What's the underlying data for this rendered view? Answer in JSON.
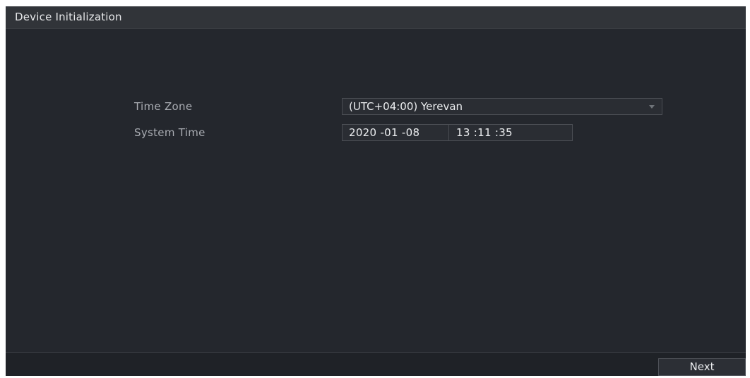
{
  "window": {
    "title": "Device Initialization"
  },
  "form": {
    "time_zone": {
      "label": "Time Zone",
      "value": "(UTC+04:00) Yerevan",
      "icon": "dropdown-arrow-icon"
    },
    "system_time": {
      "label": "System Time",
      "date": "2020 -01 -08",
      "time": "13 :11 :35"
    }
  },
  "footer": {
    "next_label": "Next"
  },
  "colors": {
    "background": "#24272d",
    "title_bar": "#313439",
    "label_text": "#a9acb2",
    "value_text": "#eceef0",
    "field_border": "#4a4d53"
  }
}
